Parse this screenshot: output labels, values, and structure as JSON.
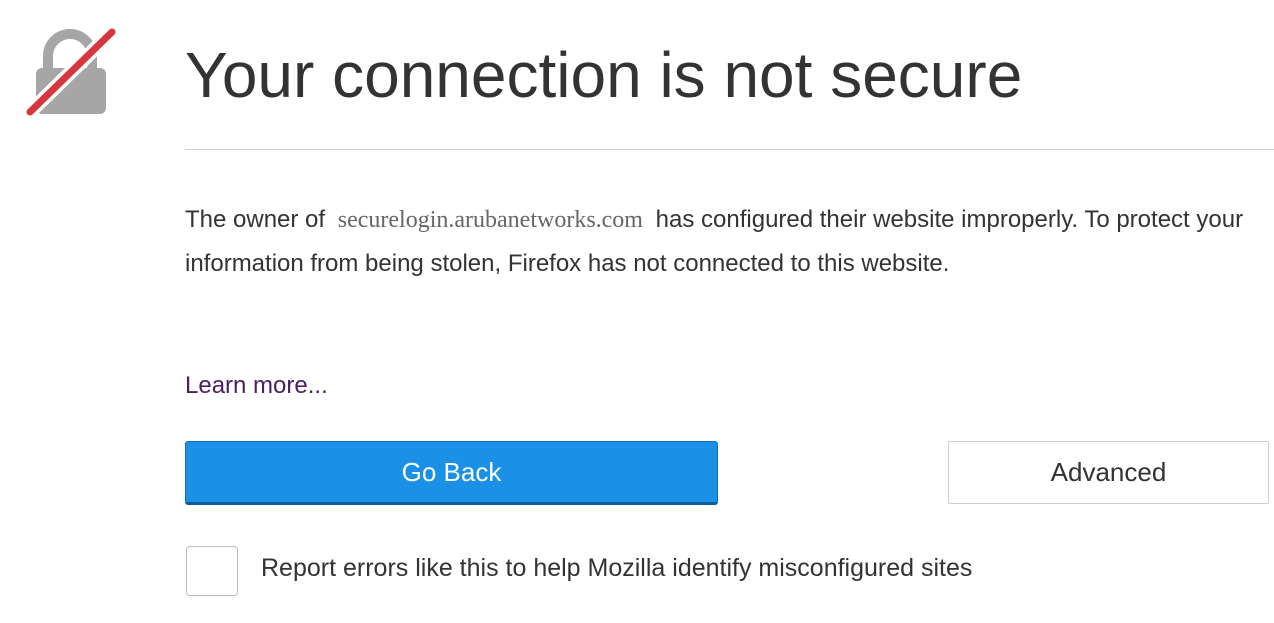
{
  "error_page": {
    "title": "Your connection is not secure",
    "description": {
      "before_domain": "The owner of",
      "domain": "securelogin.arubanetworks.com",
      "after_domain": "has configured their website improperly. To protect your information from being stolen, Firefox has not connected to this website."
    },
    "learn_more_label": "Learn more...",
    "go_back_label": "Go Back",
    "advanced_label": "Advanced",
    "report_checkbox": {
      "label": "Report errors like this to help Mozilla identify misconfigured sites",
      "checked": false
    }
  },
  "icons": {
    "header": "broken-lock-icon"
  },
  "colors": {
    "primary_button": "#1a91e6",
    "lock_gray": "#a6a6a6",
    "strike_red": "#d6363d",
    "link": "#4a2060",
    "text": "#333333"
  }
}
